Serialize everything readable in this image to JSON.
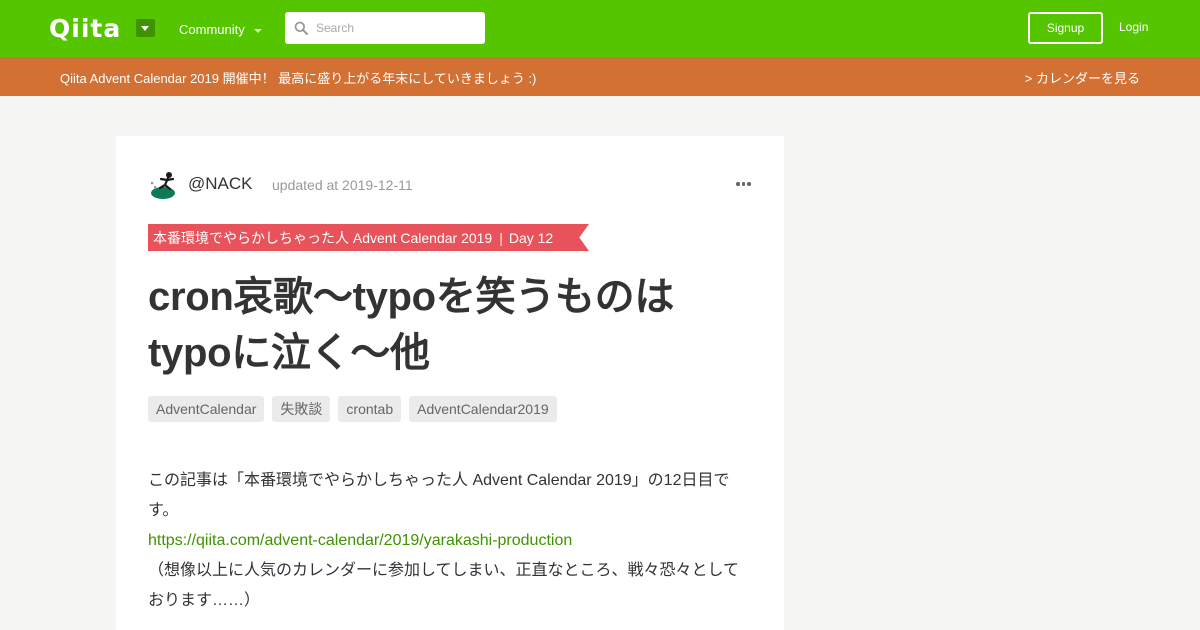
{
  "header": {
    "logo": "Qiita",
    "community_label": "Community",
    "search_placeholder": "Search",
    "signup_label": "Signup",
    "login_label": "Login"
  },
  "banner": {
    "text": "Qiita Advent Calendar 2019 開催中！ 最高に盛り上がる年末にしていきましょう :)",
    "link": "> カレンダーを見る"
  },
  "article": {
    "author": "@NACK",
    "updated": "updated at 2019-12-11",
    "calendar_name": "本番環境でやらかしちゃった人 Advent Calendar 2019",
    "calendar_day": "Day 12",
    "title_line1": "cron哀歌～typoを笑うものは",
    "title_line2": "typoに泣く～他",
    "tags": [
      "AdventCalendar",
      "失敗談",
      "crontab",
      "AdventCalendar2019"
    ],
    "body_line1": "この記事は「本番環境でやらかしちゃった人 Advent Calendar 2019」の12日目で",
    "body_line2": "す。",
    "body_link": "https://qiita.com/advent-calendar/2019/yarakashi-production",
    "body_line3": "（想像以上に人気のカレンダーに参加してしまい、正直なところ、戦々恐々として",
    "body_line4": "おります……）"
  },
  "colors": {
    "brand_green": "#55c500",
    "banner_orange": "#d27133",
    "ribbon_red": "#e8525b",
    "link_green": "#3f9300"
  },
  "icons": [
    "qiita-logo",
    "chevron-down-icon",
    "search-icon",
    "more-icon",
    "avatar"
  ]
}
